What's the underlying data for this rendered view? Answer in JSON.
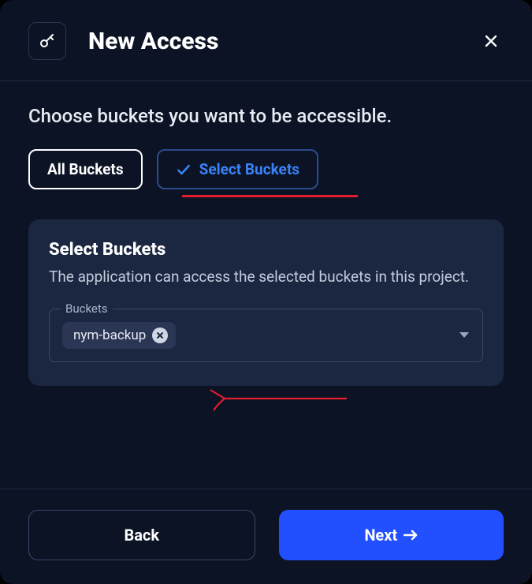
{
  "header": {
    "title": "New Access"
  },
  "body": {
    "subtitle": "Choose buckets you want to be accessible.",
    "tabs": {
      "all": "All Buckets",
      "select": "Select Buckets"
    }
  },
  "card": {
    "title": "Select Buckets",
    "desc": "The application can access the selected buckets in this project.",
    "legend": "Buckets",
    "chips": [
      {
        "label": "nym-backup"
      }
    ]
  },
  "footer": {
    "back": "Back",
    "next": "Next"
  },
  "colors": {
    "accent": "#2350ff",
    "link": "#3b82f6",
    "annotation": "#e11d2e",
    "panel": "#1b2640",
    "bg": "#0b1324"
  }
}
